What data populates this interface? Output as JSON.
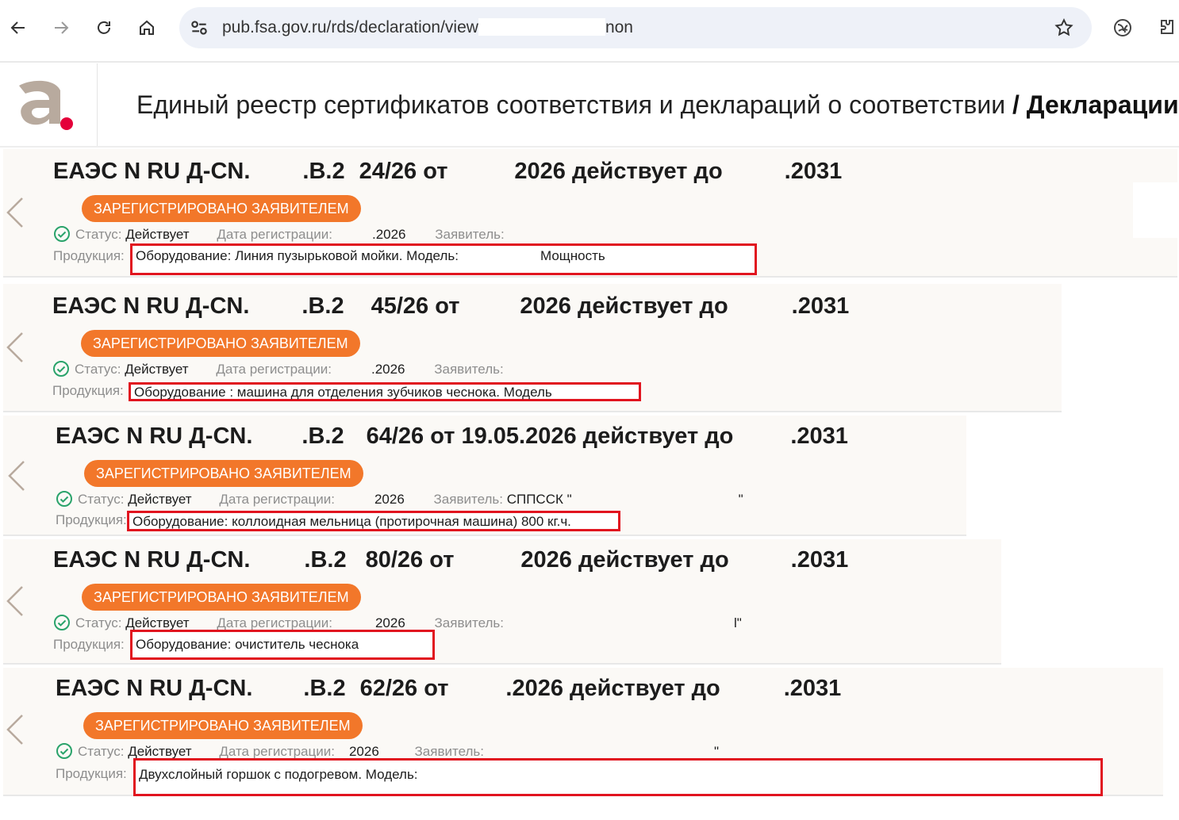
{
  "browser": {
    "url": "pub.fsa.gov.ru/rds/declaration/view",
    "url_tail": "non"
  },
  "header": {
    "title": "Единый реестр сертификатов соответствия и деклараций о соответствии",
    "section": "/ Декларации"
  },
  "colors": {
    "badge": "#f2772a",
    "highlight_box": "#e1141f",
    "card_bg": "#fbf9f6"
  },
  "labels": {
    "status": "Статус:",
    "reg_date": "Дата регистрации:",
    "applicant": "Заявитель:",
    "product": "Продукция:"
  },
  "cards": [
    {
      "title_prefix": "ЕАЭС N RU Д-CN.",
      "title_mid": ".B.2",
      "title_num": "24/26 от",
      "title_date": "2026 действует до",
      "title_end": ".2031",
      "badge": "ЗАРЕГИСТРИРОВАНО ЗАЯВИТЕЛЕМ",
      "status": "Действует",
      "reg_date": ".2026",
      "applicant": "",
      "product": "Оборудование: Линия пузырьковой мойки. Модель:",
      "product_extra": "Мощность"
    },
    {
      "title_prefix": "ЕАЭС N RU Д-CN.",
      "title_mid": ".B.2",
      "title_num": "45/26 от",
      "title_date": "2026 действует до",
      "title_end": ".2031",
      "badge": "ЗАРЕГИСТРИРОВАНО ЗАЯВИТЕЛЕМ",
      "status": "Действует",
      "reg_date": ".2026",
      "applicant": "",
      "product": "Оборудование : машина для отделения зубчиков чеснока. Модель",
      "product_extra": ""
    },
    {
      "title_prefix": "ЕАЭС N RU Д-CN.",
      "title_mid": ".B.2",
      "title_num": "64/26 от 19.05.2026 действует до",
      "title_date": "",
      "title_end": ".2031",
      "badge": "ЗАРЕГИСТРИРОВАНО ЗАЯВИТЕЛЕМ",
      "status": "Действует",
      "reg_date": "2026",
      "applicant": "СППССК \"",
      "applicant_end": "\"",
      "product": "Оборудование: коллоидная мельница (протирочная машина) 800 кг.ч.",
      "product_extra": ""
    },
    {
      "title_prefix": "ЕАЭС N RU Д-CN.",
      "title_mid": ".B.2",
      "title_num": "80/26 от",
      "title_date": "2026 действует до",
      "title_end": ".2031",
      "badge": "ЗАРЕГИСТРИРОВАНО ЗАЯВИТЕЛЕМ",
      "status": "Действует",
      "reg_date": "2026",
      "applicant": "",
      "applicant_end": "l\"",
      "product": "Оборудование: очиститель чеснока",
      "product_extra": ""
    },
    {
      "title_prefix": "ЕАЭС N RU Д-CN.",
      "title_mid": ".B.2",
      "title_num": "62/26 от",
      "title_date": ".2026 действует до",
      "title_end": ".2031",
      "badge": "ЗАРЕГИСТРИРОВАНО ЗАЯВИТЕЛЕМ",
      "status": "Действует",
      "reg_date": "2026",
      "applicant": "",
      "applicant_end": "\"",
      "product": "Двухслойный горшок с подогревом. Модель:",
      "product_extra": ""
    }
  ]
}
